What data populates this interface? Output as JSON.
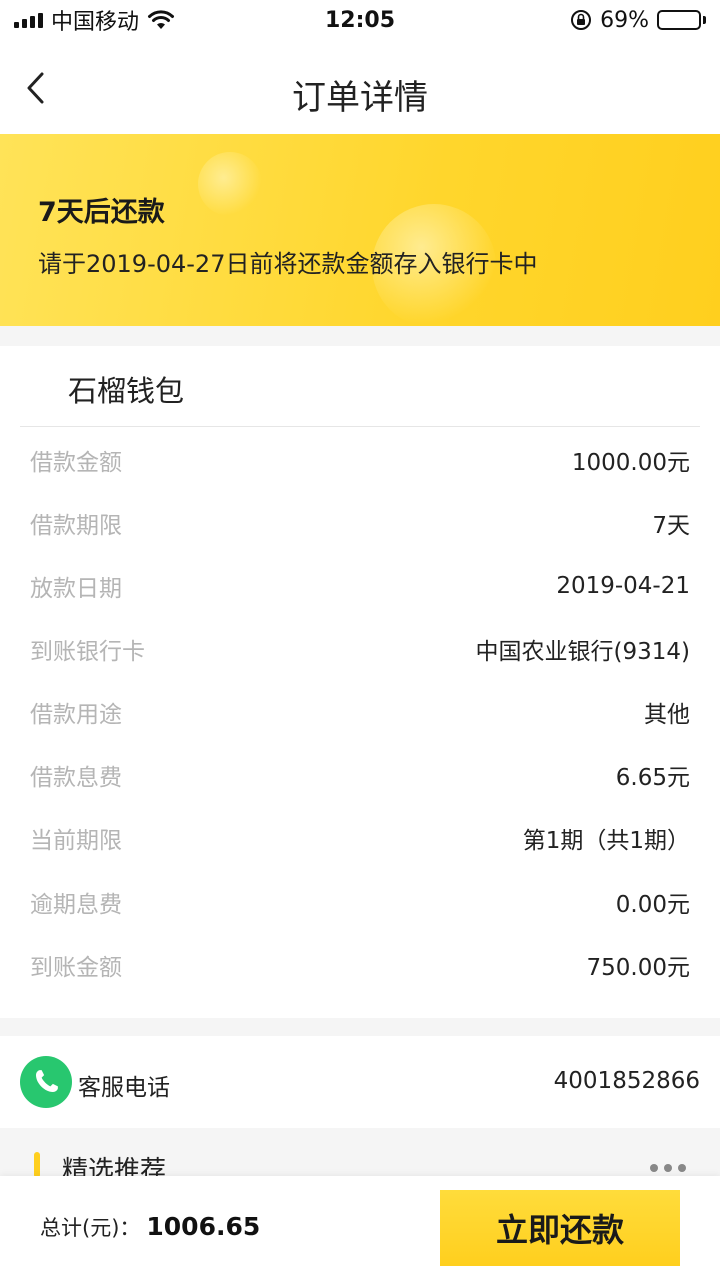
{
  "status_bar": {
    "carrier": "中国移动",
    "time": "12:05",
    "battery": "69%",
    "battery_level": 0.69,
    "icons": [
      "signal-icon",
      "wifi-icon",
      "orientation-lock-icon",
      "battery-icon"
    ]
  },
  "nav": {
    "title": "订单详情",
    "back_icon": "chevron-left-icon"
  },
  "banner": {
    "title": "7天后还款",
    "subtitle": "请于2019-04-27日前将还款金额存入银行卡中",
    "color": "#ffd62c"
  },
  "details": {
    "title": "石榴钱包",
    "rows": [
      {
        "label": "借款金额",
        "value": "1000.00元"
      },
      {
        "label": "借款期限",
        "value": "7天"
      },
      {
        "label": "放款日期",
        "value": "2019-04-21"
      },
      {
        "label": "到账银行卡",
        "value": "中国农业银行(9314)"
      },
      {
        "label": "借款用途",
        "value": "其他"
      },
      {
        "label": "借款息费",
        "value": "6.65元"
      },
      {
        "label": "当前期限",
        "value": "第1期（共1期）"
      },
      {
        "label": "逾期息费",
        "value": "0.00元"
      },
      {
        "label": "到账金额",
        "value": "750.00元"
      }
    ]
  },
  "service": {
    "label": "客服电话",
    "number": "4001852866",
    "icon": "phone-icon",
    "icon_color": "#28c76f"
  },
  "recommend": {
    "title": "精选推荐",
    "more_icon": "more-dots-icon"
  },
  "footer": {
    "total_label": "总计(元)：",
    "total_amount": "1006.65",
    "repay_button": "立即还款",
    "accent": "#ffcf1e"
  }
}
